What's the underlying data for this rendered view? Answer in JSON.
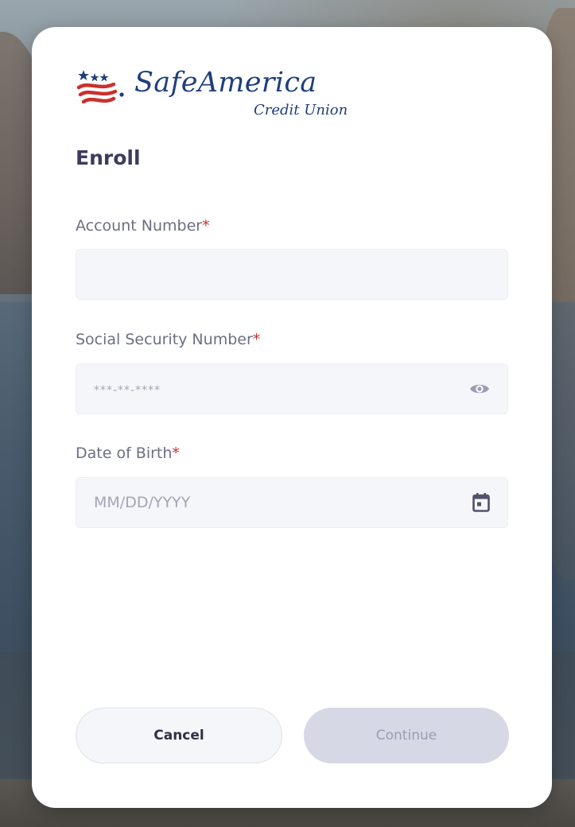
{
  "brand": {
    "name": "SafeAmerica",
    "subtitle": "Credit Union",
    "colors": {
      "navy": "#1f3f7c",
      "red": "#c8312e"
    }
  },
  "form": {
    "title": "Enroll",
    "required_marker": "*",
    "fields": [
      {
        "label": "Account Number",
        "value": "",
        "placeholder": "",
        "icon": null
      },
      {
        "label": "Social Security Number",
        "value": "",
        "placeholder": "***-**-****",
        "icon": "eye-icon"
      },
      {
        "label": "Date of Birth",
        "value": "",
        "placeholder": "MM/DD/YYYY",
        "icon": "calendar-icon"
      }
    ]
  },
  "actions": {
    "cancel_label": "Cancel",
    "continue_label": "Continue",
    "continue_enabled": false
  }
}
